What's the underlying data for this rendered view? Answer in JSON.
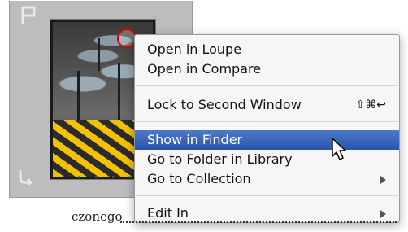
{
  "grid_cell": {
    "flag_icon": "flag-icon",
    "rotate_icon": "rotate-icon",
    "dots": "• • • • •"
  },
  "background_text": "czonego",
  "context_menu": {
    "items": [
      {
        "label": "Open in Loupe"
      },
      {
        "label": "Open in Compare"
      },
      {
        "label": "Lock to Second Window",
        "shortcut": "⇧⌘↩"
      },
      {
        "label": "Show in Finder",
        "highlighted": true
      },
      {
        "label": "Go to Folder in Library"
      },
      {
        "label": "Go to Collection",
        "submenu": true
      },
      {
        "label": "Edit In",
        "submenu": true
      }
    ],
    "highlight_color": "#3563b8"
  },
  "annotation_color": "#d40000"
}
